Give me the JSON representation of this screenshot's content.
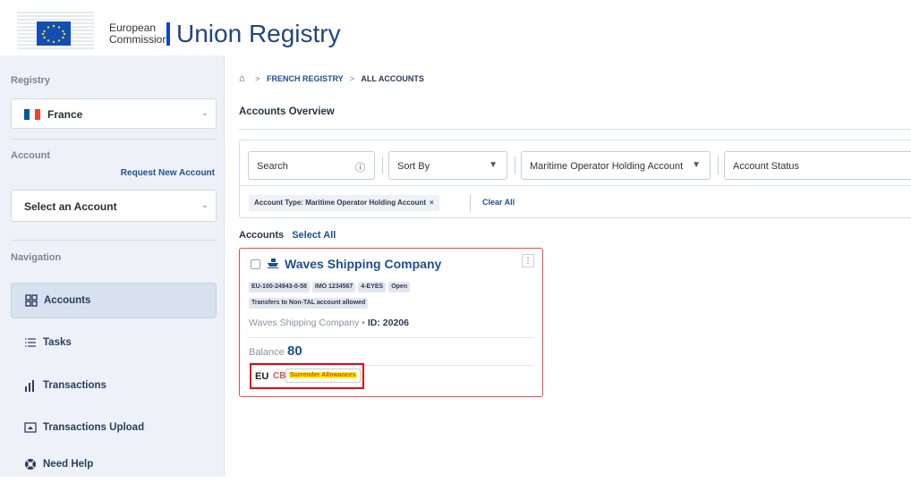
{
  "header": {
    "org_line1": "European",
    "org_line2": "Commission",
    "app_title": "Union Registry"
  },
  "sidebar": {
    "registry_label": "Registry",
    "registry_value": "France",
    "account_label": "Account",
    "request_new_account": "Request New Account",
    "account_select_placeholder": "Select an Account",
    "navigation_label": "Navigation",
    "nav_items": [
      {
        "label": "Accounts",
        "icon": "grid-icon",
        "active": true
      },
      {
        "label": "Tasks",
        "icon": "list-icon",
        "active": false
      },
      {
        "label": "Transactions",
        "icon": "bar-chart-icon",
        "active": false
      },
      {
        "label": "Transactions Upload",
        "icon": "upload-icon",
        "active": false
      },
      {
        "label": "Need Help",
        "icon": "lifebuoy-icon",
        "active": false
      }
    ],
    "colors": {
      "fr_blue": "#0055a4",
      "fr_white": "#ffffff",
      "fr_red": "#ef4135"
    }
  },
  "breadcrumb": {
    "level1": "FRENCH REGISTRY",
    "level2": "ALL ACCOUNTS"
  },
  "page_title": "Accounts Overview",
  "filters": {
    "search_placeholder": "Search",
    "sort_by": "Sort By",
    "account_type": "Maritime Operator Holding Account",
    "account_status": "Account Status",
    "active_chip": "Account Type: Maritime Operator Holding Account",
    "clear_all": "Clear All"
  },
  "accounts": {
    "header": "Accounts",
    "select_all": "Select All",
    "cards": [
      {
        "name": "Waves Shipping Company",
        "badges": [
          "EU-100-24943-0-58",
          "IMO 1234567",
          "4-EYES",
          "Open"
        ],
        "badge_line2": "Transfers to Non-TAL account allowed",
        "holder": "Waves Shipping Company",
        "id_label": "ID: 20206",
        "balance_label": "Balance",
        "balance_value": "80",
        "eu_label": "EU",
        "ets_icon": "CB",
        "status_tag": "Surrender Allowances"
      }
    ]
  }
}
